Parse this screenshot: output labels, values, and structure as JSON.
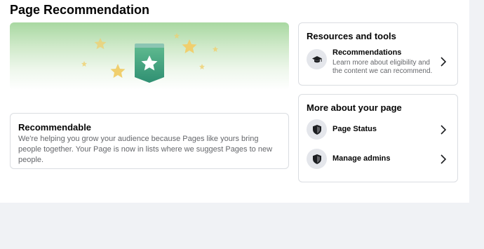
{
  "page": {
    "title": "Page Recommendation"
  },
  "recommendable": {
    "title": "Recommendable",
    "body": "We're helping you grow your audience because Pages like yours bring people together. Your Page is now in lists where we suggest Pages to new people."
  },
  "resources": {
    "heading": "Resources and tools",
    "items": [
      {
        "label": "Recommendations",
        "description": "Learn more about eligibility and the content we can recommend.",
        "icon": "graduation-cap-icon"
      }
    ]
  },
  "more": {
    "heading": "More about your page",
    "items": [
      {
        "label": "Page Status",
        "icon": "shield-icon"
      },
      {
        "label": "Manage admins",
        "icon": "shield-icon"
      }
    ]
  },
  "colors": {
    "badge": "#3f9b7e",
    "star": "#f0cf6e",
    "banner_top": "#a8d8a1"
  }
}
